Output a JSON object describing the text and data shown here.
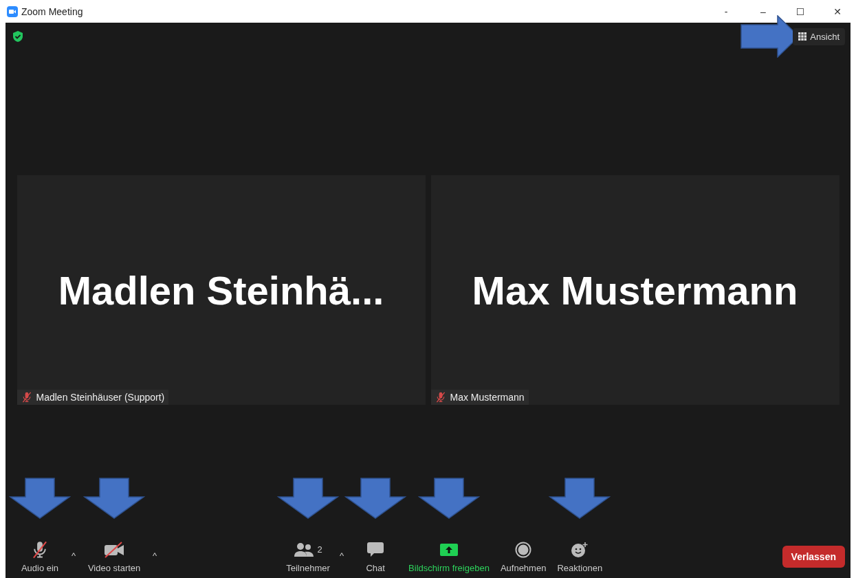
{
  "window": {
    "title": "Zoom Meeting",
    "controls": [
      "-",
      "–",
      "☐",
      "✕"
    ]
  },
  "view_button": {
    "label": "Ansicht",
    "highlighted": true
  },
  "tiles": [
    {
      "display_name": "Madlen Steinhä...",
      "name_tag": "Madlen Steinhäuser (Support)",
      "muted": true
    },
    {
      "display_name": "Max Mustermann",
      "name_tag": "Max Mustermann",
      "muted": true
    }
  ],
  "toolbar_left": [
    {
      "kind": "audio",
      "label": "Audio ein",
      "off": true,
      "caret": "^",
      "highlighted": true
    },
    {
      "kind": "video",
      "label": "Video starten",
      "off": true,
      "caret": "^",
      "highlighted": true
    }
  ],
  "toolbar_center": [
    {
      "kind": "participants",
      "label": "Teilnehmer",
      "badge": "2",
      "caret": "^",
      "highlighted": true
    },
    {
      "kind": "chat",
      "label": "Chat",
      "highlighted": true
    },
    {
      "kind": "share",
      "label": "Bildschirm freigeben",
      "highlighted": true
    },
    {
      "kind": "record",
      "label": "Aufnehmen",
      "highlighted": false
    },
    {
      "kind": "reactions",
      "label": "Reaktionen",
      "highlighted": true
    }
  ],
  "leave_button": {
    "label": "Verlassen"
  }
}
